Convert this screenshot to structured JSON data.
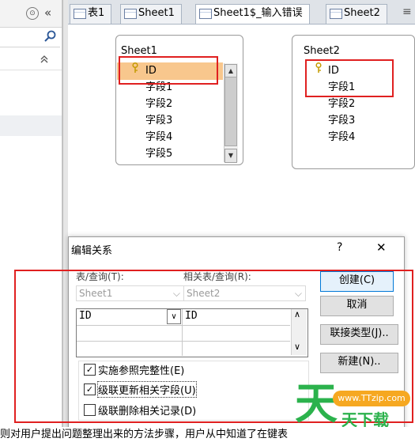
{
  "nav": {
    "circle_btn": "⊙",
    "collapse": "«",
    "search_icon": "⚲",
    "group_chevron": "⌃"
  },
  "tabs": [
    {
      "label": "表1"
    },
    {
      "label": "Sheet1"
    },
    {
      "label": "Sheet1$_输入错误"
    },
    {
      "label": "Sheet2"
    }
  ],
  "tab_overflow": "≡",
  "sheet1": {
    "title": "Sheet1",
    "fields": [
      "ID",
      "字段1",
      "字段2",
      "字段3",
      "字段4",
      "字段5"
    ],
    "pk_icon": "key-icon"
  },
  "sheet2": {
    "title": "Sheet2",
    "fields": [
      "ID",
      "字段1",
      "字段2",
      "字段3",
      "字段4"
    ],
    "pk_icon": "key-icon"
  },
  "dialog": {
    "title": "编辑关系",
    "help": "?",
    "close": "✕",
    "label_table": "表/查询(T):",
    "label_related": "相关表/查询(R):",
    "table_value": "Sheet1",
    "related_value": "Sheet2",
    "grid_left": "ID",
    "grid_right": "ID",
    "checks": [
      {
        "label": "实施参照完整性(E)",
        "checked": true
      },
      {
        "label": "级联更新相关字段(U)",
        "checked": true
      },
      {
        "label": "级联删除相关记录(D)",
        "checked": false
      }
    ],
    "buttons": {
      "create": "创建(C)",
      "cancel": "取消",
      "join": "联接类型(J)..",
      "new": "新建(N).."
    }
  },
  "watermark": {
    "url": "www.TTzip.com",
    "big": "天",
    "small": "天下载"
  },
  "bottom_text": "则对用户提出问题整理出来的方法步骤，用户从中知道了在键表"
}
